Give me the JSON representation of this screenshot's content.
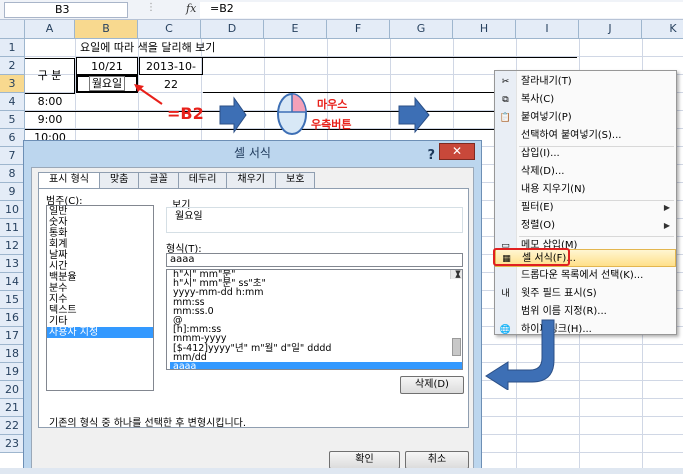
{
  "formula_bar": {
    "name_box": "B3",
    "fx": "fx",
    "value": "=B2"
  },
  "columns": [
    "A",
    "B",
    "C",
    "D",
    "E",
    "F",
    "G",
    "H",
    "I",
    "J",
    "K"
  ],
  "rows": [
    "1",
    "2",
    "3",
    "4",
    "5",
    "6",
    "7",
    "8",
    "9",
    "10",
    "11",
    "12",
    "13",
    "14",
    "15",
    "16",
    "17",
    "18",
    "19",
    "20",
    "21",
    "22",
    "23"
  ],
  "cells": {
    "b1": "요일에 따라 색을 달리해 보기",
    "a2": "구 분",
    "b2": "10/21",
    "c2": "2013-10-22",
    "b3": "월요일",
    "a4": "8:00",
    "a5": "9:00",
    "a6": "10:00"
  },
  "annotations": {
    "formula_label": "=B2",
    "mouse_label_1": "마우스",
    "mouse_label_2": "우측버튼"
  },
  "dialog": {
    "title": "셀 서식",
    "help": "?",
    "close": "✕",
    "tabs": [
      "표시 형식",
      "맞춤",
      "글꼴",
      "테두리",
      "채우기",
      "보호"
    ],
    "category_label": "범주(C):",
    "categories": [
      "일반",
      "숫자",
      "통화",
      "회계",
      "날짜",
      "시간",
      "백분율",
      "분수",
      "지수",
      "텍스트",
      "기타",
      "사용자 지정"
    ],
    "sample_label": "보기",
    "sample_value": "월요일",
    "type_label": "형식(T):",
    "type_input": "aaaa",
    "types": [
      "h\"시\" mm\"분\"",
      "h\"시\" mm\"분\" ss\"초\"",
      "yyyy-mm-dd h:mm",
      "mm:ss",
      "mm:ss.0",
      "@",
      "[h]:mm:ss",
      "mmm-yyyy",
      "[$-412]yyyy\"년\" m\"월\" d\"일\" dddd",
      "mm/dd",
      "aaaa"
    ],
    "delete_button": "삭제(D)",
    "hint": "기존의 형식 중 하나를 선택한 후 변형시킵니다.",
    "ok_button": "확인",
    "cancel_button": "취소"
  },
  "context_menu": {
    "items": [
      {
        "label": "잘라내기(T)",
        "icon": "scissors-icon"
      },
      {
        "label": "복사(C)",
        "icon": "copy-icon"
      },
      {
        "label": "붙여넣기(P)",
        "icon": "paste-icon"
      },
      {
        "label": "선택하여 붙여넣기(S)...",
        "icon": ""
      },
      {
        "label": "삽입(I)...",
        "icon": ""
      },
      {
        "label": "삭제(D)...",
        "icon": ""
      },
      {
        "label": "내용 지우기(N)",
        "icon": ""
      },
      {
        "label": "필터(E)",
        "icon": "",
        "submenu": true
      },
      {
        "label": "정렬(O)",
        "icon": "",
        "submenu": true
      },
      {
        "label": "메모 삽입(M)",
        "icon": "comment-icon"
      },
      {
        "label": "셀 서식(F)...",
        "icon": "format-cells-icon"
      },
      {
        "label": "드롭다운 목록에서 선택(K)...",
        "icon": ""
      },
      {
        "label": "윗주 필드 표시(S)",
        "icon": "phonetic-icon"
      },
      {
        "label": "범위 이름 지정(R)...",
        "icon": ""
      },
      {
        "label": "하이퍼링크(H)...",
        "icon": "hyperlink-icon"
      }
    ]
  },
  "colors": {
    "accent_red": "#e8201a",
    "arrow_blue": "#3d6fb5",
    "selection": "#3399ff"
  }
}
